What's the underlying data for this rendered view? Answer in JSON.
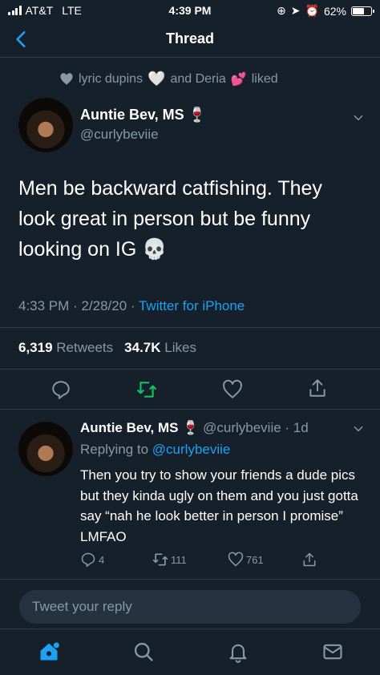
{
  "status_bar": {
    "carrier": "AT&T",
    "network": "LTE",
    "time": "4:39 PM",
    "battery": "62%",
    "battery_level": 0.62
  },
  "nav": {
    "title": "Thread"
  },
  "liked_by": {
    "user1": "lyric dupins",
    "conj": "and Deria",
    "suffix": "liked"
  },
  "tweet": {
    "author_name": "Auntie Bev, MS",
    "author_emoji": "🍷",
    "author_handle": "@curlybeviie",
    "text": "Men be backward catfishing. They look great in person but be funny looking on IG 💀",
    "time": "4:33 PM",
    "date": "2/28/20",
    "source": "Twitter for iPhone",
    "retweets": "6,319",
    "retweets_label": "Retweets",
    "likes": "34.7K",
    "likes_label": "Likes"
  },
  "reply": {
    "author_name": "Auntie Bev, MS",
    "author_emoji": "🍷",
    "handle_time": "@curlybeviie · 1d",
    "replying_label": "Replying to",
    "replying_handle": "@curlybeviie",
    "text": "Then you try to show your friends a dude pics but they kinda ugly on them and you just gotta say “nah he look better in person I promise” LMFAO",
    "reply_count": "4",
    "retweet_count": "111",
    "like_count": "761"
  },
  "composer": {
    "placeholder": "Tweet your reply"
  },
  "icons": [
    "back-icon",
    "heart-icon",
    "chevron-down-icon",
    "reply-icon",
    "retweet-icon",
    "like-icon",
    "share-icon",
    "home-icon",
    "search-icon",
    "notifications-icon",
    "messages-icon"
  ],
  "colors": {
    "background": "#15202b",
    "accent": "#1da1f2",
    "retweet_green": "#17bf63",
    "secondary_text": "#8899a6"
  }
}
